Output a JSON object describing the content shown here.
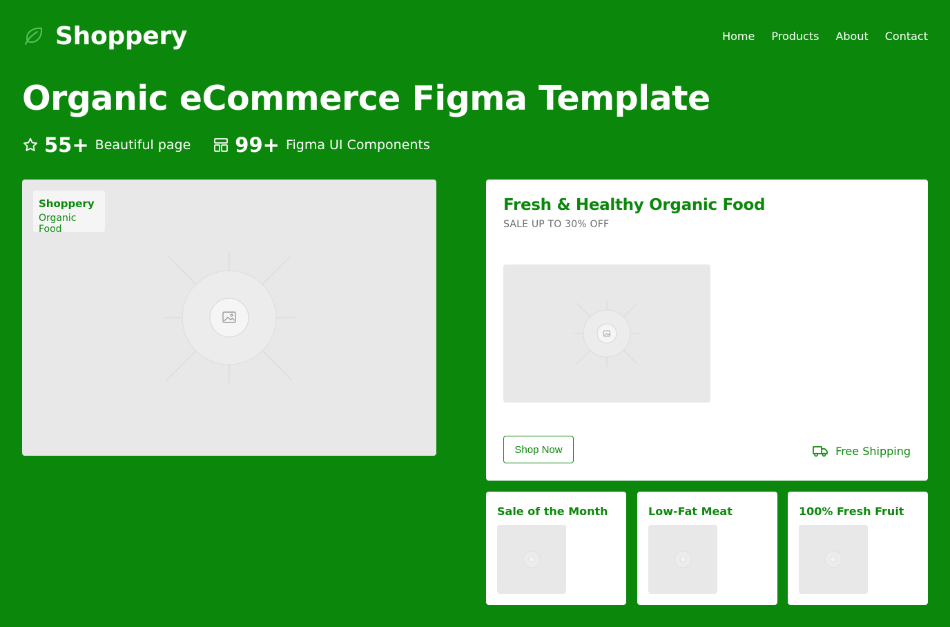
{
  "brand": {
    "name": "Shoppery",
    "icon": "leaf-icon"
  },
  "nav": {
    "items": [
      "Home",
      "Products",
      "About",
      "Contact"
    ]
  },
  "hero": {
    "title": "Organic eCommerce Figma Template",
    "stats": [
      {
        "icon": "star-icon",
        "number": "55+",
        "label": "Beautiful page"
      },
      {
        "icon": "layout-icon",
        "number": "99+",
        "label": "Figma UI Components"
      }
    ],
    "image": {
      "icon": "image-placeholder-icon",
      "badge_title": "Shoppery",
      "badge_subtitle": "Organic Food"
    }
  },
  "promo": {
    "title": "Fresh & Healthy Organic Food",
    "subtitle": "SALE UP TO 30% OFF",
    "button_label": "Shop Now",
    "shipping_label": "Free Shipping",
    "shipping_icon": "truck-icon"
  },
  "mini_cards": [
    {
      "title": "Sale of the Month"
    },
    {
      "title": "Low-Fat Meat"
    },
    {
      "title": "100% Fresh Fruit"
    }
  ],
  "colors": {
    "brand_green": "#0b880b",
    "placeholder_gray": "#e8e8e8",
    "white": "#ffffff"
  }
}
